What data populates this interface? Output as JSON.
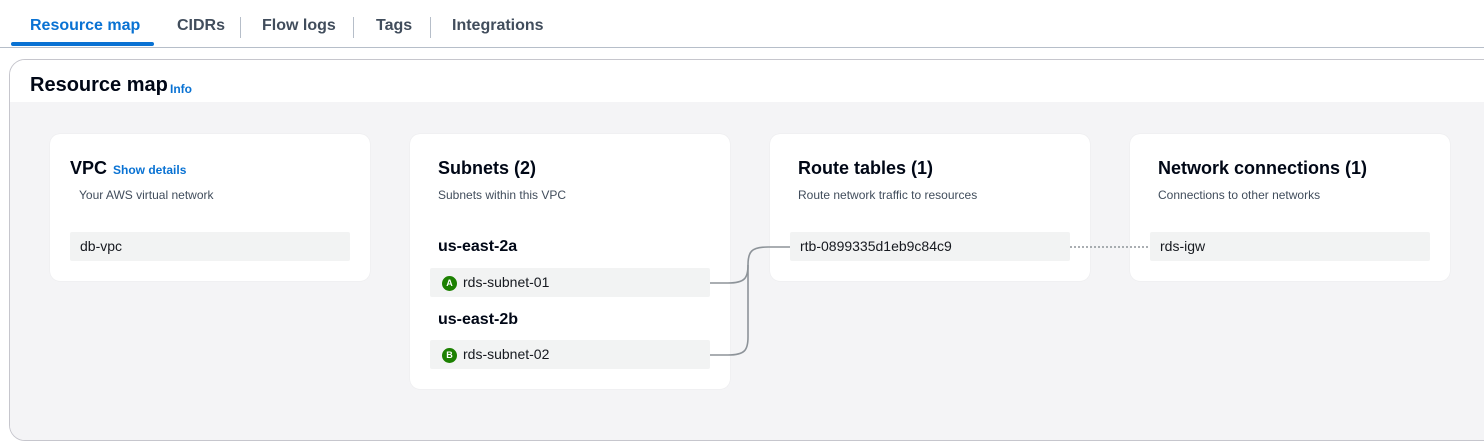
{
  "tabs": [
    {
      "label": "Resource map",
      "active": true
    },
    {
      "label": "CIDRs"
    },
    {
      "label": "Flow logs"
    },
    {
      "label": "Tags"
    },
    {
      "label": "Integrations"
    }
  ],
  "panel": {
    "title": "Resource map",
    "info_label": "Info"
  },
  "vpc": {
    "title": "VPC",
    "show_details": "Show details",
    "description": "Your AWS virtual network",
    "node": "db-vpc"
  },
  "subnets": {
    "title": "Subnets (2)",
    "description": "Subnets within this VPC",
    "zones": [
      {
        "name": "us-east-2a",
        "badge": "A",
        "subnet": "rds-subnet-01"
      },
      {
        "name": "us-east-2b",
        "badge": "B",
        "subnet": "rds-subnet-02"
      }
    ]
  },
  "route_tables": {
    "title": "Route tables (1)",
    "description": "Route network traffic to resources",
    "node": "rtb-0899335d1eb9c84c9"
  },
  "network_connections": {
    "title": "Network connections (1)",
    "description": "Connections to other networks",
    "node": "rds-igw"
  },
  "colors": {
    "accent": "#0972d3",
    "az_badge": "#1d8102",
    "map_background": "#f4f4f6"
  }
}
